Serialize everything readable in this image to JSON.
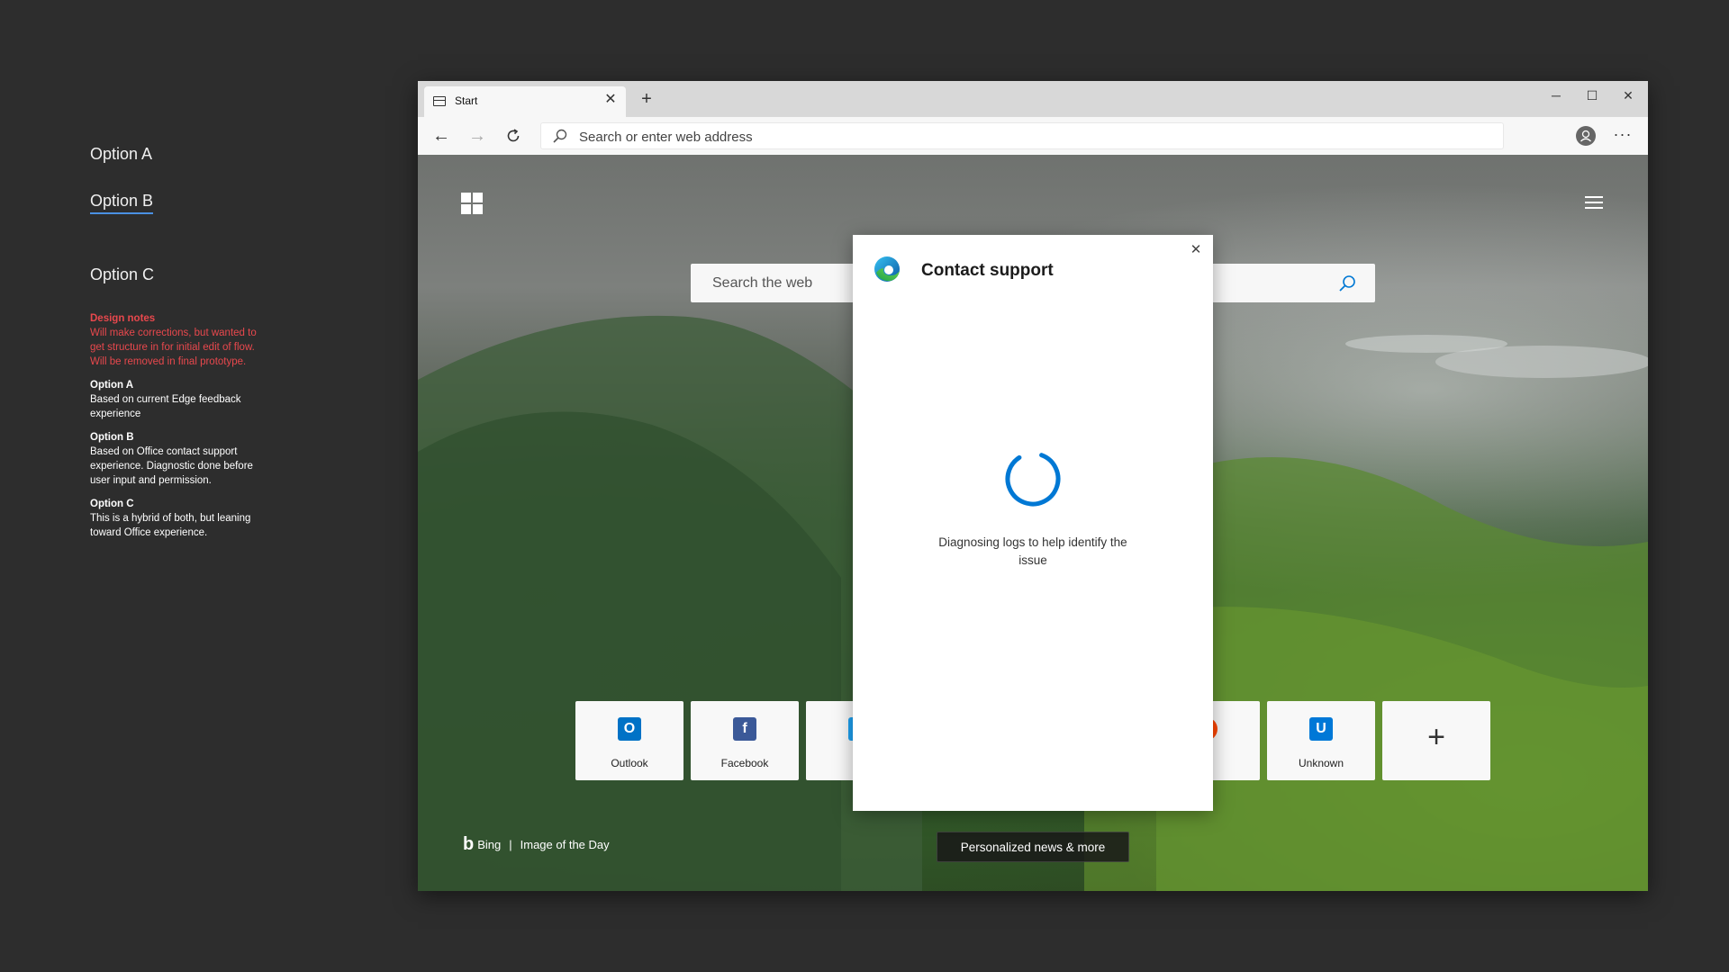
{
  "left_panel": {
    "options": [
      "Option A",
      "Option B",
      "Option C"
    ],
    "active_option": "Option B",
    "design_notes_title": "Design notes",
    "design_notes_text": "Will make corrections, but wanted to get structure in for initial edit of flow. Will be removed in final prototype.",
    "notes": [
      {
        "title": "Option A",
        "text": "Based on current Edge feedback experience"
      },
      {
        "title": "Option B",
        "text": "Based on Office contact support experience. Diagnostic done before user input and permission."
      },
      {
        "title": "Option C",
        "text": "This is a hybrid of both, but leaning toward Office experience."
      }
    ]
  },
  "browser": {
    "tab": {
      "title": "Start",
      "icon": "page-icon"
    },
    "address_bar": {
      "placeholder": "Search or enter web address"
    },
    "window_controls": {
      "minimize": "─",
      "maximize": "☐",
      "close": "✕"
    }
  },
  "new_tab_page": {
    "search": {
      "placeholder": "Search the web"
    },
    "top_sites": [
      {
        "label": "Outlook",
        "icon": "outlook-icon",
        "color": "#0072c6",
        "glyph": "O"
      },
      {
        "label": "Facebook",
        "icon": "facebook-icon",
        "color": "#3b5998",
        "glyph": "f"
      },
      {
        "label": "Tw",
        "icon": "twitter-icon",
        "color": "#1da1f2",
        "glyph": ""
      },
      {
        "label": "lit",
        "icon": "reddit-icon",
        "color": "#ff4500",
        "glyph": ""
      },
      {
        "label": "Unknown",
        "icon": "unknown-site-icon",
        "color": "#0078d7",
        "glyph": "U"
      },
      {
        "label": "",
        "icon": "add-site-icon",
        "color": "",
        "glyph": "+"
      }
    ],
    "bing": {
      "brand": "Bing",
      "separator": "|",
      "caption": "Image of the Day"
    },
    "news_button": "Personalized news & more"
  },
  "dialog": {
    "title": "Contact support",
    "message": "Diagnosing logs to help identify the issue",
    "close": "✕"
  }
}
